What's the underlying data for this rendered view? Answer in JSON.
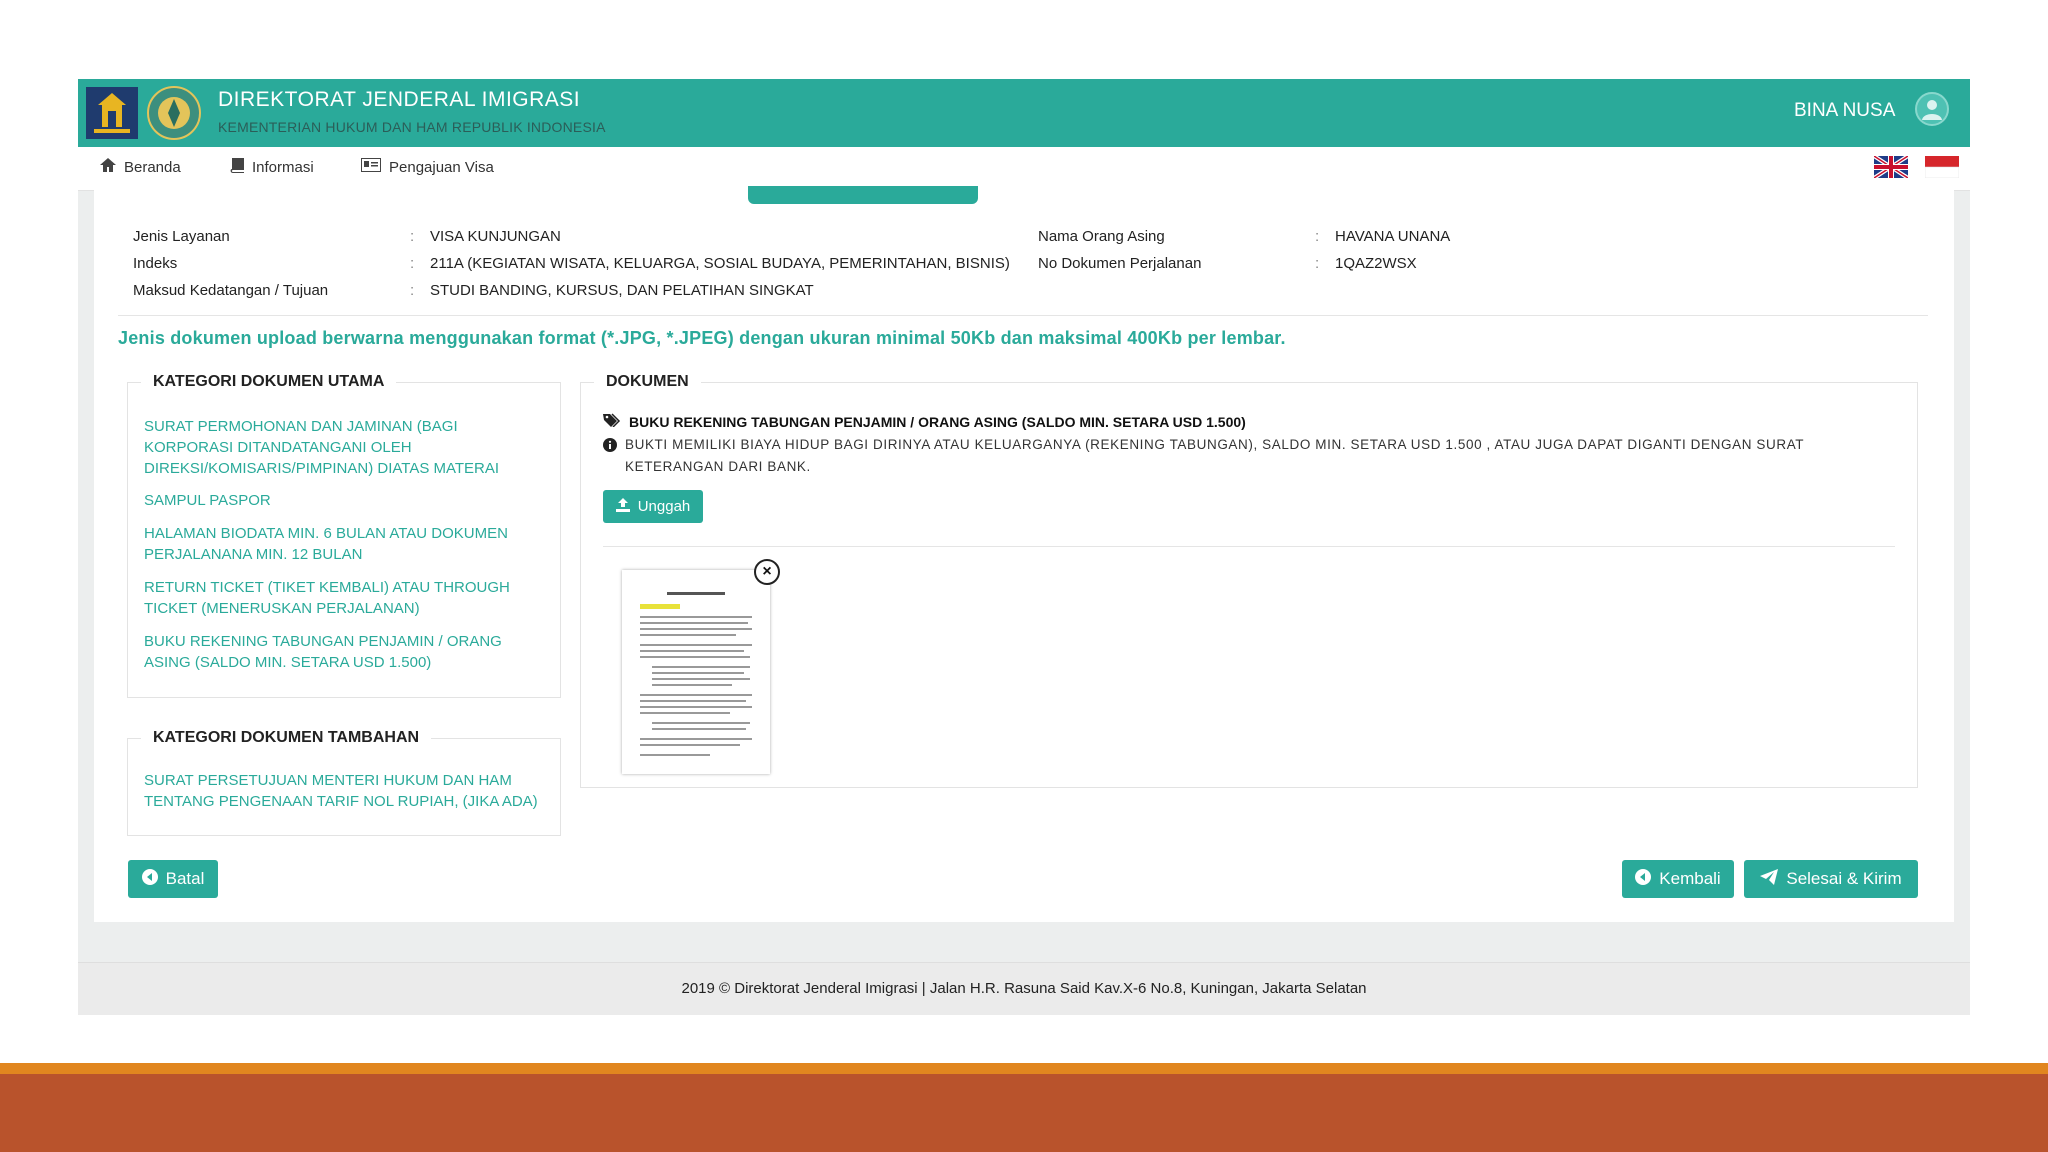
{
  "header": {
    "title": "DIREKTORAT JENDERAL IMIGRASI",
    "subtitle": "KEMENTERIAN HUKUM DAN HAM REPUBLIK INDONESIA",
    "user_name": "BINA NUSA",
    "brand_color": "#2aaa9a"
  },
  "nav": {
    "items": [
      {
        "label": "Beranda",
        "icon": "home-icon"
      },
      {
        "label": "Informasi",
        "icon": "book-icon"
      },
      {
        "label": "Pengajuan Visa",
        "icon": "id-card-icon"
      }
    ],
    "languages": [
      "english-flag-icon",
      "indonesia-flag-icon"
    ]
  },
  "info": {
    "left": [
      {
        "label": "Jenis Layanan",
        "value": "VISA KUNJUNGAN"
      },
      {
        "label": "Indeks",
        "value": "211A   (KEGIATAN WISATA, KELUARGA, SOSIAL BUDAYA, PEMERINTAHAN, BISNIS)"
      },
      {
        "label": "Maksud Kedatangan / Tujuan",
        "value": "STUDI BANDING, KURSUS, DAN PELATIHAN SINGKAT"
      }
    ],
    "right": [
      {
        "label": "Nama Orang Asing",
        "value": "HAVANA UNANA"
      },
      {
        "label": "No Dokumen Perjalanan",
        "value": "1QAZ2WSX"
      }
    ]
  },
  "notice": "Jenis dokumen upload berwarna menggunakan format (*.JPG, *.JPEG) dengan ukuran minimal 50Kb dan maksimal 400Kb per lembar.",
  "kategori_utama": {
    "title": "KATEGORI DOKUMEN UTAMA",
    "items": [
      "SURAT PERMOHONAN DAN JAMINAN (BAGI KORPORASI DITANDATANGANI OLEH DIREKSI/KOMISARIS/PIMPINAN) DIATAS MATERAI",
      "SAMPUL PASPOR",
      "HALAMAN BIODATA MIN. 6 BULAN ATAU DOKUMEN PERJALANANA MIN. 12 BULAN",
      "RETURN TICKET (TIKET KEMBALI) ATAU THROUGH TICKET (MENERUSKAN PERJALANAN)",
      "BUKU REKENING TABUNGAN PENJAMIN / ORANG ASING (SALDO MIN. SETARA USD 1.500)"
    ]
  },
  "kategori_tambahan": {
    "title": "KATEGORI DOKUMEN TAMBAHAN",
    "items": [
      "SURAT PERSETUJUAN MENTERI HUKUM DAN HAM TENTANG PENGENAAN TARIF NOL RUPIAH, (JIKA ADA)"
    ]
  },
  "dokumen": {
    "title": "DOKUMEN",
    "doc_name": "BUKU REKENING TABUNGAN PENJAMIN / ORANG ASING (SALDO MIN. SETARA USD 1.500)",
    "doc_desc": "BUKTI MEMILIKI BIAYA HIDUP BAGI DIRINYA ATAU KELUARGANYA (REKENING TABUNGAN), SALDO MIN. SETARA USD 1.500 , ATAU JUGA DAPAT DIGANTI DENGAN SURAT KETERANGAN DARI BANK.",
    "upload_label": "Unggah"
  },
  "actions": {
    "cancel": "Batal",
    "back": "Kembali",
    "submit": "Selesai & Kirim"
  },
  "footer": "2019 © Direktorat Jenderal Imigrasi | Jalan H.R. Rasuna Said Kav.X-6 No.8, Kuningan, Jakarta Selatan"
}
